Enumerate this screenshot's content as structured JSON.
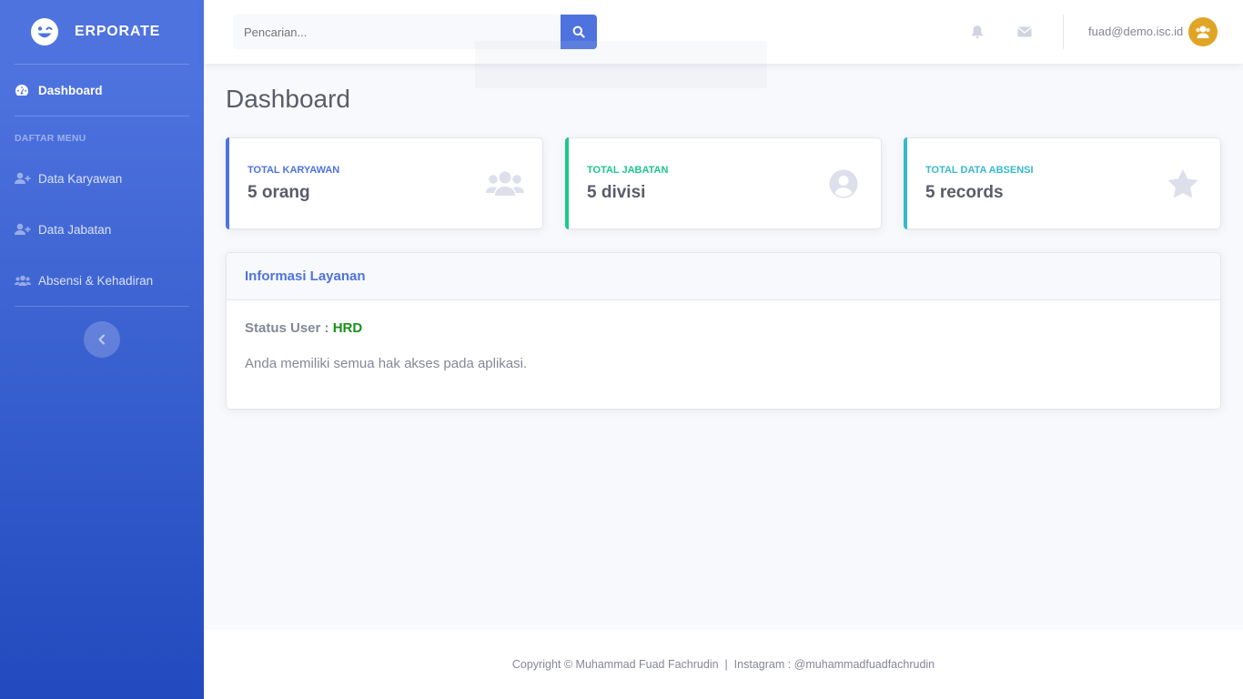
{
  "brand": {
    "name": "ERPORATE",
    "icon": "laugh-wink-icon"
  },
  "sidebar": {
    "items": [
      {
        "label": "Dashboard",
        "icon": "tachometer-icon",
        "active": true
      },
      {
        "label": "Data Karyawan",
        "icon": "user-plus-icon"
      },
      {
        "label": "Data Jabatan",
        "icon": "user-plus-icon"
      },
      {
        "label": "Absensi & Kehadiran",
        "icon": "users-icon"
      }
    ],
    "heading": "DAFTAR MENU",
    "toggle_icon": "chevron-left-icon"
  },
  "topbar": {
    "search_placeholder": "Pencarian...",
    "search_icon": "search-icon",
    "bell_icon": "bell-icon",
    "mail_icon": "envelope-icon",
    "user_email": "fuad@demo.isc.id",
    "avatar_icon": "users-avatar-icon"
  },
  "page": {
    "title": "Dashboard"
  },
  "cards": [
    {
      "label": "TOTAL KARYAWAN",
      "value": "5 orang",
      "icon": "users-icon",
      "color": "#4e73df"
    },
    {
      "label": "TOTAL JABATAN",
      "value": "5 divisi",
      "icon": "user-circle-icon",
      "color": "#1cc88a"
    },
    {
      "label": "TOTAL DATA ABSENSI",
      "value": "5 records",
      "icon": "star-icon",
      "color": "#36b9cc"
    }
  ],
  "info": {
    "title": "Informasi Layanan",
    "status_label": "Status User :",
    "status_value": "HRD",
    "description": "Anda memiliki semua hak akses pada aplikasi."
  },
  "footer": {
    "text": "Copyright © Muhammad Fuad Fachrudin  |  Instagram : @muhammadfuadfachrudin"
  }
}
